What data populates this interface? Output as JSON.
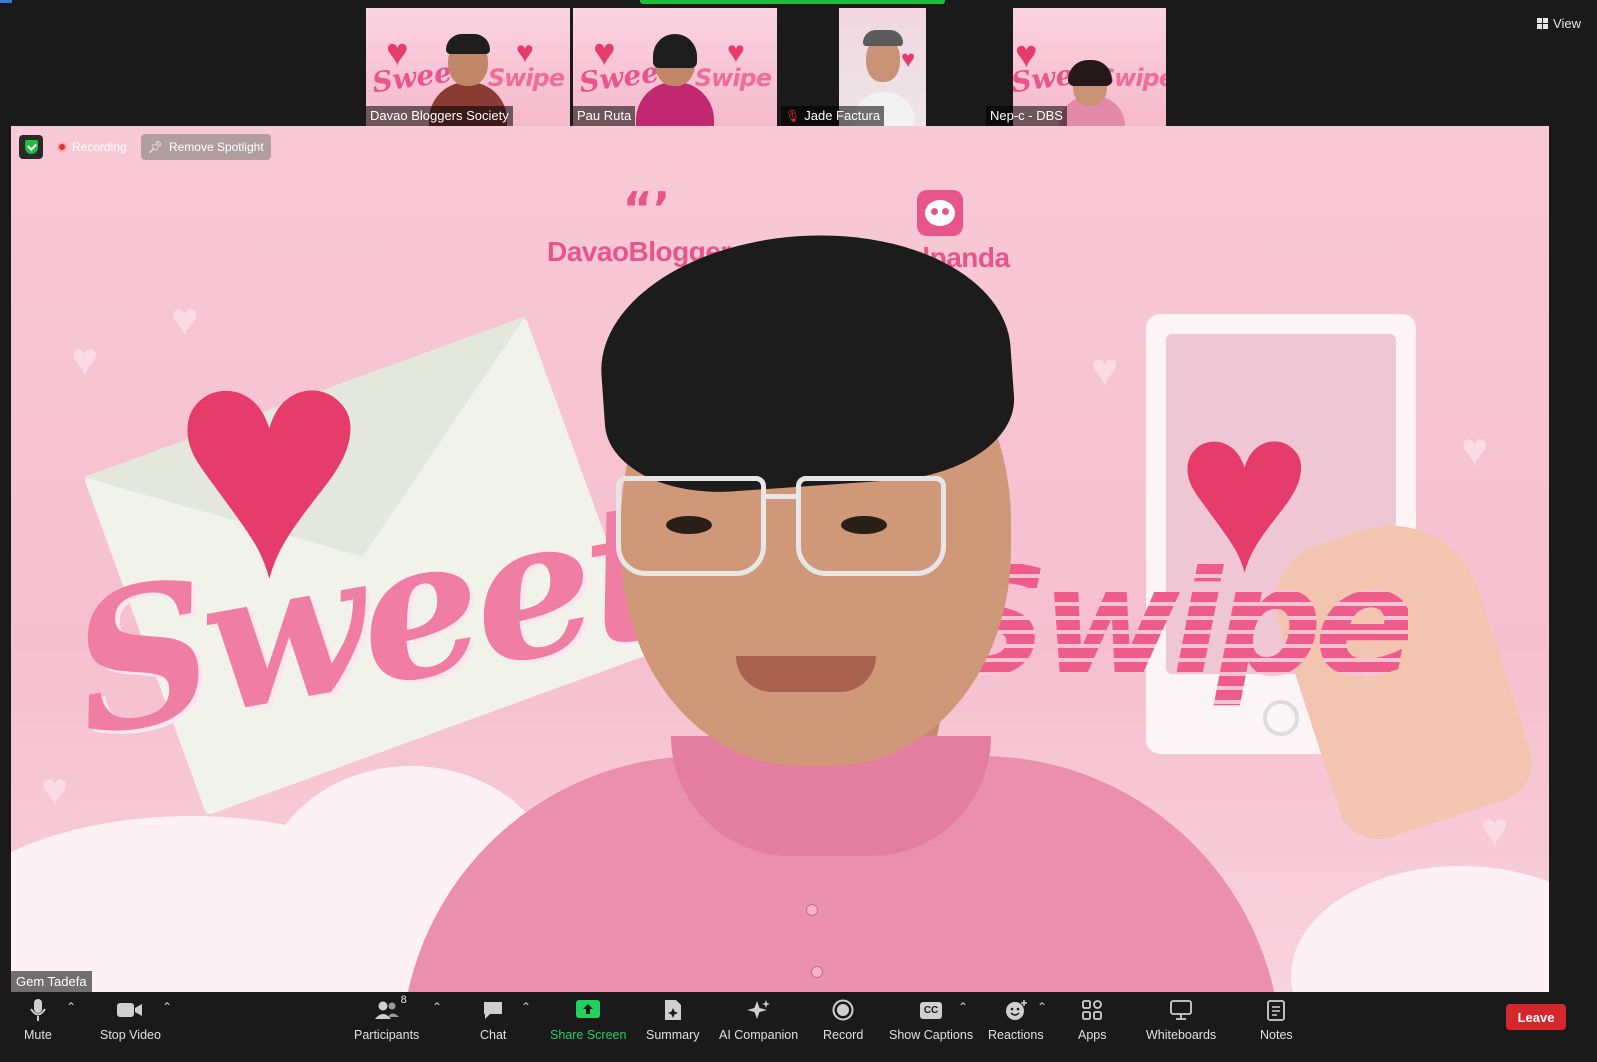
{
  "view_label": "View",
  "thumbnails": [
    {
      "name": "Davao Bloggers Society",
      "muted": false
    },
    {
      "name": "Pau Ruta",
      "muted": false
    },
    {
      "name": "Jade Factura",
      "muted": true
    },
    {
      "name": "Nep-c - DBS",
      "muted": false
    }
  ],
  "thumb_texts": {
    "sweet": "Sweet",
    "swipe": "Swipe"
  },
  "stage": {
    "recording_label": "Recording",
    "remove_spotlight_label": "Remove Spotlight",
    "speaker_name": "Gem Tadefa",
    "logo_left_mark": "“’",
    "logo_left_text": "DavaoBloggers",
    "logo_right_text": "foodpanda",
    "sweet_text": "Sweet",
    "swipe_text": "Swipe"
  },
  "toolbar": {
    "mute": "Mute",
    "stop_video": "Stop Video",
    "participants": "Participants",
    "participants_count": "8",
    "chat": "Chat",
    "share_screen": "Share Screen",
    "summary": "Summary",
    "ai_companion": "AI Companion",
    "record": "Record",
    "show_captions": "Show Captions",
    "captions_icon_text": "CC",
    "reactions": "Reactions",
    "apps": "Apps",
    "whiteboards": "Whiteboards",
    "notes": "Notes",
    "leave": "Leave"
  },
  "colors": {
    "accent_green": "#23d160",
    "leave_red": "#d4272b",
    "brand_pink": "#e8558a"
  }
}
